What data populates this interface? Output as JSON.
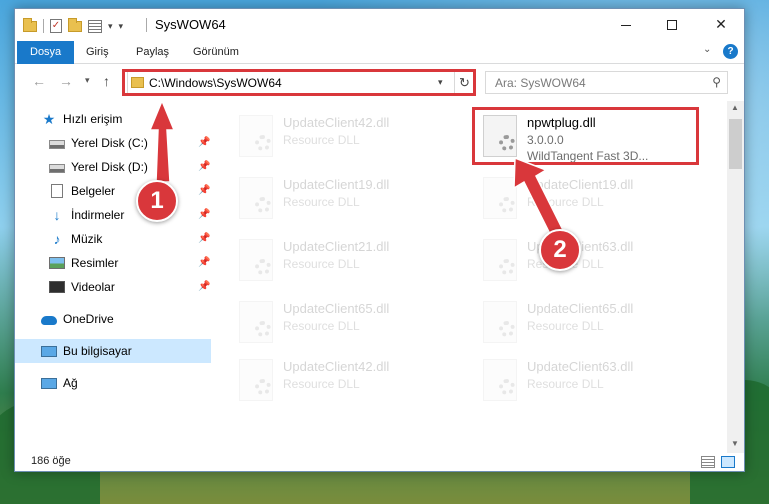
{
  "window": {
    "title": "SysWOW64",
    "controls": {
      "minimize": "",
      "maximize": "",
      "close": "✕"
    }
  },
  "ribbon": {
    "tabs": [
      "Dosya",
      "Giriş",
      "Paylaş",
      "Görünüm"
    ],
    "expand_glyph": "⌄",
    "help_glyph": "?"
  },
  "address": {
    "path": "C:\\Windows\\SysWOW64",
    "refresh_glyph": "↻"
  },
  "search": {
    "placeholder": "Ara: SysWOW64",
    "icon": "search-icon"
  },
  "sidebar": {
    "items": [
      {
        "label": "Hızlı erişim",
        "icon": "star-icon",
        "pinned": false
      },
      {
        "label": "Yerel Disk (C:)",
        "icon": "disk-icon",
        "pinned": true
      },
      {
        "label": "Yerel Disk (D:)",
        "icon": "disk-icon",
        "pinned": true
      },
      {
        "label": "Belgeler",
        "icon": "document-icon",
        "pinned": true
      },
      {
        "label": "İndirmeler",
        "icon": "download-icon",
        "pinned": true
      },
      {
        "label": "Müzik",
        "icon": "music-icon",
        "pinned": true
      },
      {
        "label": "Resimler",
        "icon": "pictures-icon",
        "pinned": true
      },
      {
        "label": "Videolar",
        "icon": "video-icon",
        "pinned": true
      },
      {
        "label": "OneDrive",
        "icon": "onedrive-icon",
        "pinned": false
      },
      {
        "label": "Bu bilgisayar",
        "icon": "computer-icon",
        "pinned": false,
        "selected": true
      },
      {
        "label": "Ağ",
        "icon": "network-icon",
        "pinned": false
      }
    ]
  },
  "files": [
    {
      "name": "UpdateClient42.dll",
      "type": "Resource DLL",
      "faded": true
    },
    {
      "name": "npwtplug.dll",
      "version": "3.0.0.0",
      "description": "WildTangent Fast 3D...",
      "faded": false
    },
    {
      "name": "UpdateClient19.dll",
      "type": "Resource DLL",
      "faded": true
    },
    {
      "name": "UpdateClient19.dll",
      "type": "Resource DLL",
      "faded": true
    },
    {
      "name": "UpdateClient21.dll",
      "type": "Resource DLL",
      "faded": true
    },
    {
      "name": "UpdateClient63.dll",
      "type": "Resource DLL",
      "faded": true
    },
    {
      "name": "UpdateClient65.dll",
      "type": "Resource DLL",
      "faded": true
    },
    {
      "name": "UpdateClient65.dll",
      "type": "Resource DLL",
      "faded": true
    },
    {
      "name": "UpdateClient42.dll",
      "type": "Resource DLL",
      "faded": true
    },
    {
      "name": "UpdateClient63.dll",
      "type": "Resource DLL",
      "faded": true
    }
  ],
  "status": {
    "item_count": "186 öğe"
  },
  "annotations": {
    "step1": "1",
    "step2": "2",
    "highlight_color": "#d9373b"
  },
  "colors": {
    "accent": "#1979ca",
    "selection": "#cce8ff"
  }
}
